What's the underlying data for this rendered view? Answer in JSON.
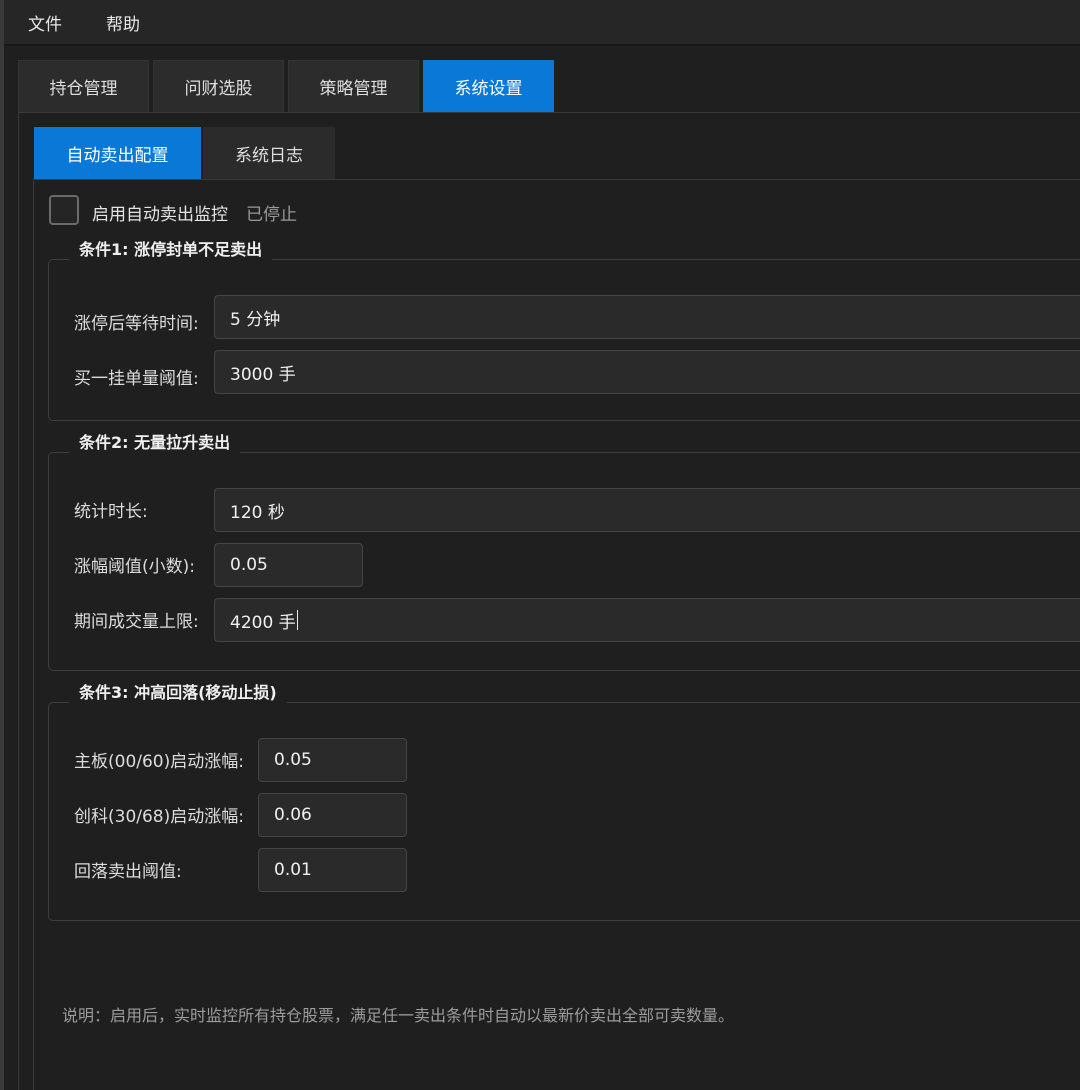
{
  "menubar": {
    "file": "文件",
    "help": "帮助"
  },
  "main_tabs": [
    {
      "label": "持仓管理",
      "active": false
    },
    {
      "label": "问财选股",
      "active": false
    },
    {
      "label": "策略管理",
      "active": false
    },
    {
      "label": "系统设置",
      "active": true
    }
  ],
  "sub_tabs": [
    {
      "label": "自动卖出配置",
      "active": true
    },
    {
      "label": "系统日志",
      "active": false
    }
  ],
  "monitor": {
    "checkbox_label": "启用自动卖出监控",
    "checked": false,
    "status": "已停止"
  },
  "condition1": {
    "title": "条件1: 涨停封单不足卖出",
    "wait_label": "涨停后等待时间:",
    "wait_value": "5 分钟",
    "buy1_label": "买一挂单量阈值:",
    "buy1_value": "3000 手"
  },
  "condition2": {
    "title": "条件2: 无量拉升卖出",
    "duration_label": "统计时长:",
    "duration_value": "120 秒",
    "rise_label": "涨幅阈值(小数):",
    "rise_value": "0.05",
    "volume_label": "期间成交量上限:",
    "volume_value": "4200 手"
  },
  "condition3": {
    "title": "条件3: 冲高回落(移动止损)",
    "main_label": "主板(00/60)启动涨幅:",
    "main_value": "0.05",
    "gem_label": "创科(30/68)启动涨幅:",
    "gem_value": "0.06",
    "pullback_label": "回落卖出阈值:",
    "pullback_value": "0.01"
  },
  "note": "说明：启用后，实时监控所有持仓股票，满足任一卖出条件时自动以最新价卖出全部可卖数量。",
  "colors": {
    "accent": "#0a78d6",
    "background": "#1f1f1f",
    "field_bg": "#2a2a2a"
  }
}
